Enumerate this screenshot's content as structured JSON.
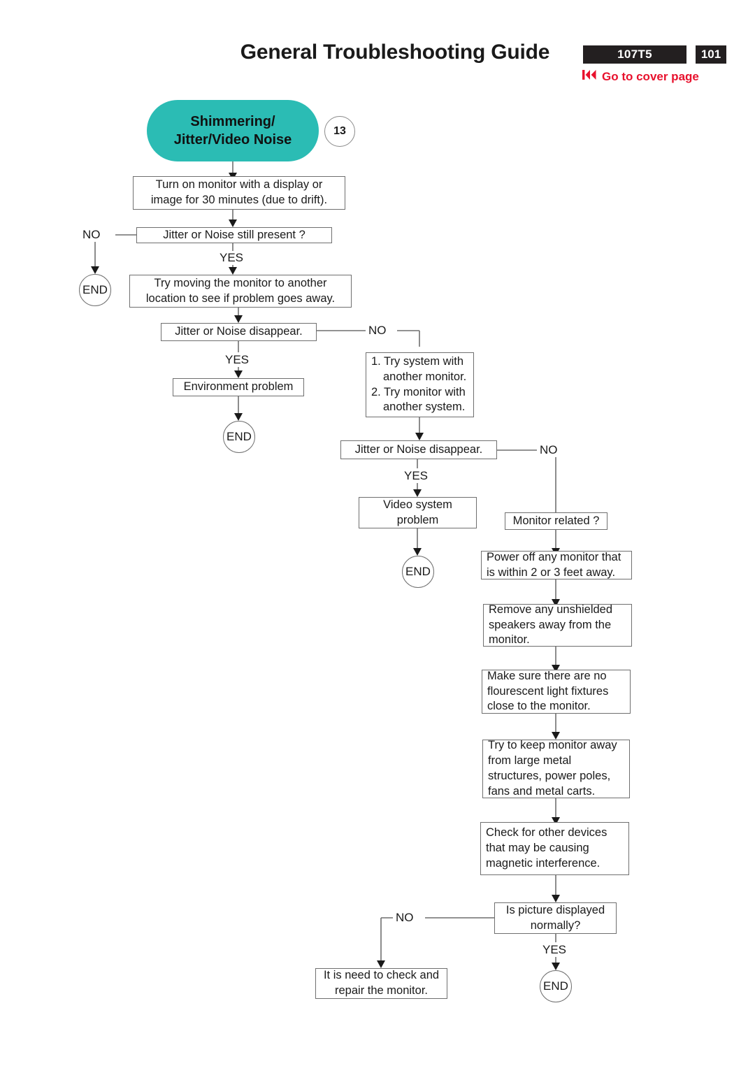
{
  "header": {
    "title": "General Troubleshooting Guide",
    "model_badge": "107T5",
    "page_badge": "101",
    "cover_link": "Go to cover page",
    "rewind_icon": "skip-to-start-icon",
    "accent_red": "#e8112d",
    "badge_black": "#231f20"
  },
  "flow": {
    "title_capsule": {
      "line1": "Shimmering/",
      "line2": "Jitter/Video Noise",
      "color": "#2bbcb4",
      "step_number": "13"
    },
    "nodes": [
      {
        "id": "n1",
        "text": "Turn on monitor with a display or image for 30 minutes (due to drift)."
      },
      {
        "id": "n2",
        "text": "Jitter or Noise still present ?"
      },
      {
        "id": "n3",
        "text": "Try moving the monitor to another location to see if problem goes away."
      },
      {
        "id": "n4",
        "text": "Jitter or Noise disappear."
      },
      {
        "id": "n5",
        "text": "Environment problem"
      },
      {
        "id": "n6",
        "line1": "1. Try system with",
        "line2": "another monitor.",
        "line3": "2. Try monitor with",
        "line4": "another system."
      },
      {
        "id": "n7",
        "text": "Jitter or Noise disappear."
      },
      {
        "id": "n8",
        "line1": "Video system",
        "line2": "problem"
      },
      {
        "id": "n9",
        "text": "Monitor related ?"
      },
      {
        "id": "n10",
        "text": "Power off any monitor that is within 2 or 3 feet away."
      },
      {
        "id": "n11",
        "text": "Remove any unshielded speakers away from the monitor."
      },
      {
        "id": "n12",
        "text": "Make sure there are no flourescent light fixtures close to the monitor."
      },
      {
        "id": "n13",
        "text": "Try to keep monitor away from large metal structures, power poles, fans and metal carts."
      },
      {
        "id": "n14",
        "text": "Check for other devices that may be causing magnetic interference."
      },
      {
        "id": "n15",
        "line1": "Is picture displayed",
        "line2": "normally?"
      },
      {
        "id": "n16",
        "line1": "It is need to check and",
        "line2": "repair the monitor."
      }
    ],
    "terminators": [
      {
        "id": "end1",
        "text": "END"
      },
      {
        "id": "end2",
        "text": "END"
      },
      {
        "id": "end3",
        "text": "END"
      },
      {
        "id": "end4",
        "text": "END"
      }
    ],
    "edge_labels": [
      {
        "id": "e1",
        "text": "NO"
      },
      {
        "id": "e2",
        "text": "YES"
      },
      {
        "id": "e3",
        "text": "YES"
      },
      {
        "id": "e4",
        "text": "NO"
      },
      {
        "id": "e5",
        "text": "YES"
      },
      {
        "id": "e6",
        "text": "NO"
      },
      {
        "id": "e7",
        "text": "NO"
      },
      {
        "id": "e8",
        "text": "YES"
      }
    ]
  }
}
